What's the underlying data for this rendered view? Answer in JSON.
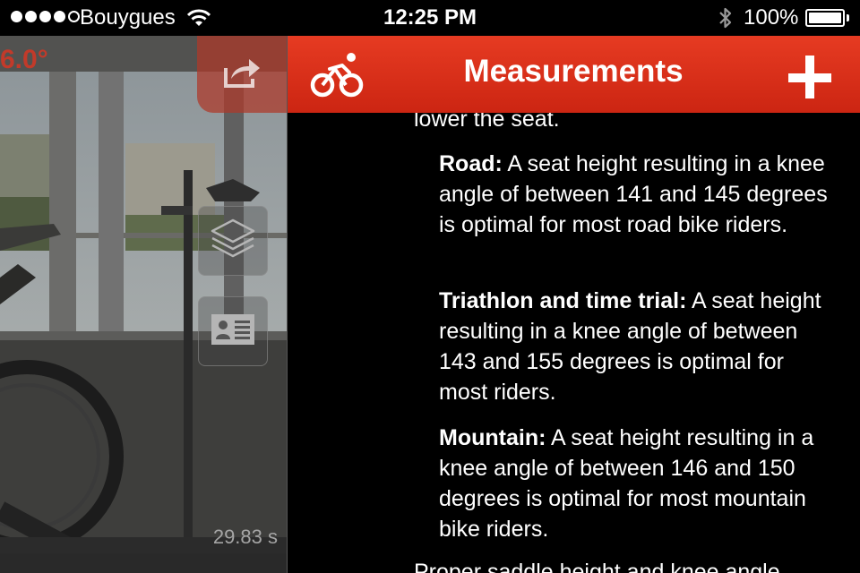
{
  "status_bar": {
    "carrier": "Bouygues",
    "time": "12:25 PM",
    "battery": "100%",
    "signal_bars_filled": 4,
    "signal_bars_total": 5,
    "battery_level": 1.0
  },
  "camera": {
    "angle_readout": "6.0°",
    "timer": "29.83 s"
  },
  "nav": {
    "title": "Measurements",
    "bike_icon": "bike-icon",
    "add_icon": "plus-icon",
    "background": "#d92e17"
  },
  "article": {
    "prev_tail": "lower the seat.",
    "items": [
      {
        "label": "Road:",
        "text": " A seat height resulting in a knee angle of between 141 and 145 degrees is optimal for most road bike riders."
      },
      {
        "label": "Triathlon and time trial:",
        "text": " A seat height resulting in a knee angle of between 143 and 155 degrees is optimal for most riders."
      },
      {
        "label": "Mountain:",
        "text": " A seat height resulting in a knee angle of between 146 and 150 degrees is optimal for most mountain bike riders."
      }
    ],
    "next_head": "Proper saddle height and knee angle"
  },
  "icons": {
    "share": "share-icon",
    "layers": "layers-icon",
    "card": "contact-card-icon"
  }
}
